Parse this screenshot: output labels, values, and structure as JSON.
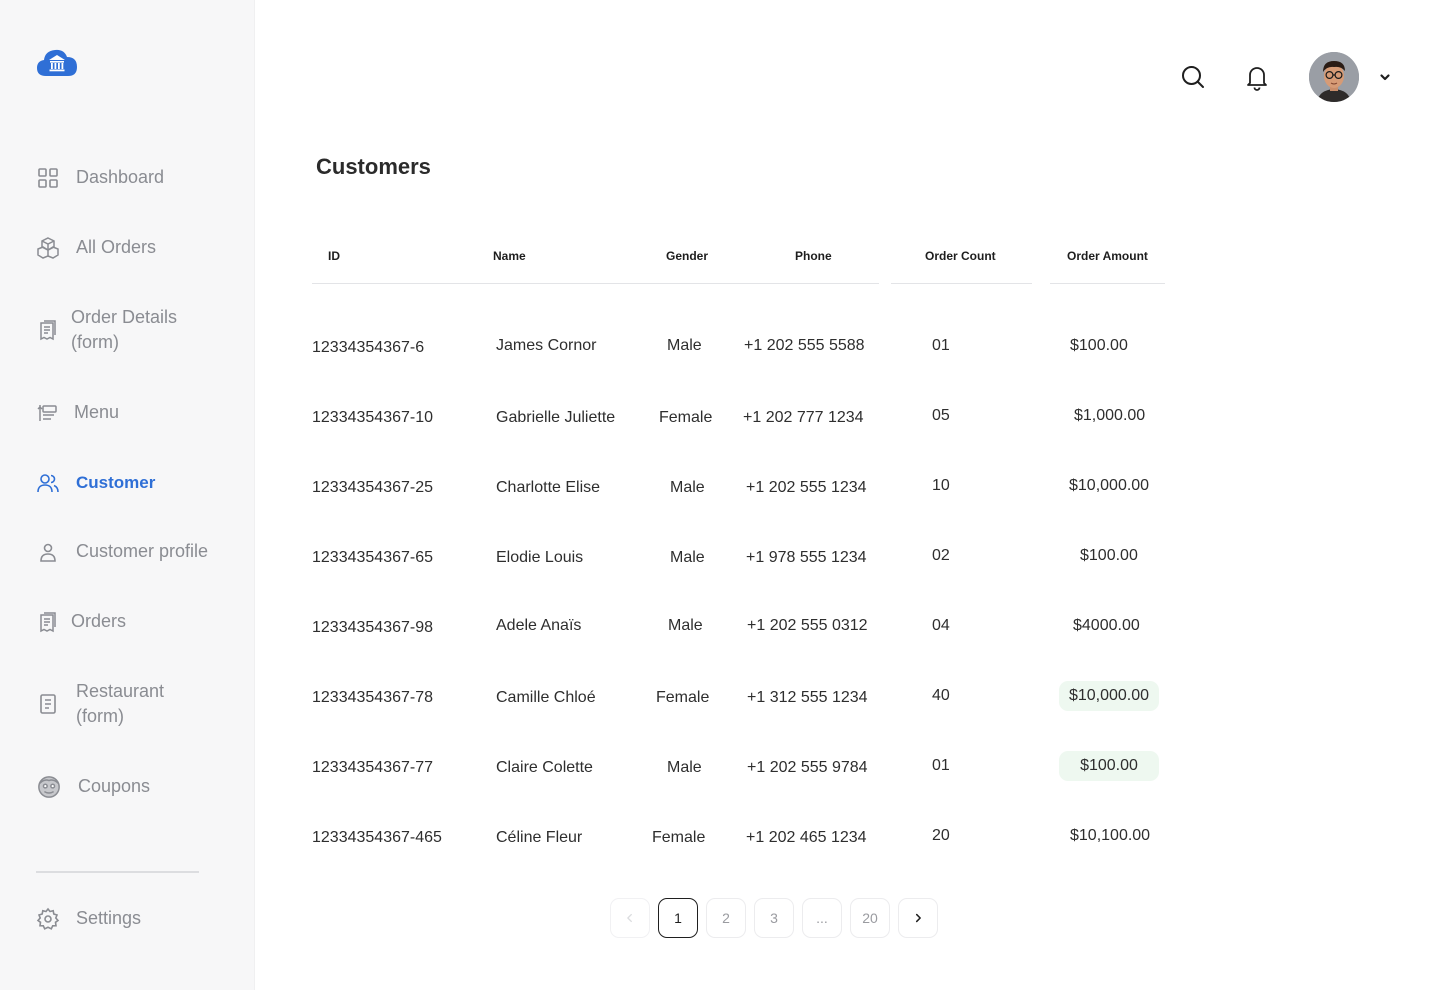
{
  "brand": {
    "logo_icon": "cloud-bank-icon",
    "accent": "#2f6fd6"
  },
  "sidebar": {
    "items": [
      {
        "label": "Dashboard",
        "icon": "dashboard-grid-icon"
      },
      {
        "label": "All Orders",
        "icon": "boxes-icon"
      },
      {
        "label": "Order Details (form)",
        "icon": "receipt-icon"
      },
      {
        "label": "Menu",
        "icon": "menu-board-icon"
      },
      {
        "label": "Customer",
        "icon": "users-icon",
        "active": true
      },
      {
        "label": "Customer profile",
        "icon": "user-icon"
      },
      {
        "label": "Orders",
        "icon": "receipt-icon"
      },
      {
        "label": "Restaurant (form)",
        "icon": "document-icon"
      },
      {
        "label": "Coupons",
        "icon": "coupon-face-icon"
      }
    ],
    "settings": {
      "label": "Settings",
      "icon": "gear-icon"
    }
  },
  "header": {
    "search_icon": "search-icon",
    "bell_icon": "bell-icon",
    "avatar": "user-avatar",
    "caret_icon": "chevron-down-icon"
  },
  "page": {
    "title": "Customers"
  },
  "table": {
    "columns": [
      "ID",
      "Name",
      "Gender",
      "Phone",
      "Order Count",
      "Order Amount"
    ],
    "rows": [
      {
        "id": "12334354367-6",
        "name": "James Cornor",
        "gender": "Male",
        "phone": "+1 202 555 5588",
        "count": "01",
        "amount": "$100.00",
        "highlight": false
      },
      {
        "id": "12334354367-10",
        "name": "Gabrielle Juliette",
        "gender": "Female",
        "phone": "+1 202 777 1234",
        "count": "05",
        "amount": "$1,000.00",
        "highlight": false
      },
      {
        "id": "12334354367-25",
        "name": "Charlotte Elise",
        "gender": "Male",
        "phone": "+1 202 555 1234",
        "count": "10",
        "amount": "$10,000.00",
        "highlight": false
      },
      {
        "id": "12334354367-65",
        "name": "Elodie Louis",
        "gender": "Male",
        "phone": "+1 978 555 1234",
        "count": "02",
        "amount": "$100.00",
        "highlight": false
      },
      {
        "id": "12334354367-98",
        "name": "Adele Anaïs",
        "gender": "Male",
        "phone": "+1 202 555 0312",
        "count": "04",
        "amount": "$4000.00",
        "highlight": false
      },
      {
        "id": "12334354367-78",
        "name": "Camille Chloé",
        "gender": "Female",
        "phone": "+1 312 555 1234",
        "count": "40",
        "amount": "$10,000.00",
        "highlight": true
      },
      {
        "id": "12334354367-77",
        "name": "Claire Colette",
        "gender": "Male",
        "phone": "+1 202 555 9784",
        "count": "01",
        "amount": "$100.00",
        "highlight": true
      },
      {
        "id": "12334354367-465",
        "name": "Céline Fleur",
        "gender": "Female",
        "phone": "+1 202 465 1234",
        "count": "20",
        "amount": "$10,100.00",
        "highlight": false
      }
    ],
    "highlight_color": "#eef8f0"
  },
  "pagination": {
    "prev_icon": "chevron-left-icon",
    "next_icon": "chevron-right-icon",
    "pages": [
      "1",
      "2",
      "3",
      "...",
      "20"
    ],
    "current": "1"
  }
}
